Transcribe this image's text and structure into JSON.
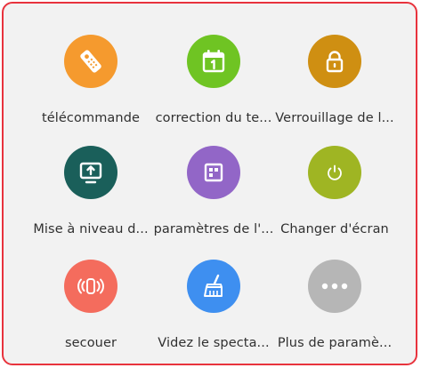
{
  "colors": {
    "border": "#e8333d",
    "background": "#f2f2f2",
    "text": "#303030"
  },
  "tiles": [
    {
      "label": "télécommande",
      "icon": "remote-control-icon",
      "color": "#f59a2e"
    },
    {
      "label": "correction du te...",
      "icon": "calendar-icon",
      "color": "#6fc423"
    },
    {
      "label": "Verrouillage de l...",
      "icon": "lock-icon",
      "color": "#cf8f12"
    },
    {
      "label": "Mise à niveau d...",
      "icon": "upgrade-icon",
      "color": "#1a5f5a"
    },
    {
      "label": "paramètres de l'...",
      "icon": "layout-grid-icon",
      "color": "#9266c7"
    },
    {
      "label": "Changer d'écran",
      "icon": "power-icon",
      "color": "#9fb523"
    },
    {
      "label": "secouer",
      "icon": "shake-icon",
      "color": "#f46c5d"
    },
    {
      "label": "Videz le specta...",
      "icon": "broom-icon",
      "color": "#3e8ff0"
    },
    {
      "label": "Plus de paramè...",
      "icon": "more-icon",
      "color": "#b6b6b6"
    }
  ]
}
